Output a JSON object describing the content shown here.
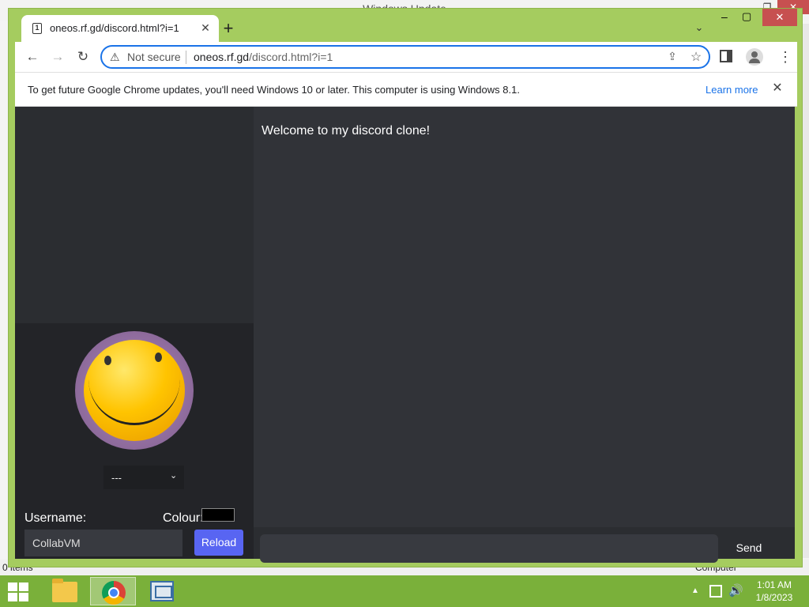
{
  "background_window": {
    "title": "Windows Update",
    "status_left": "0 items",
    "status_right": "Computer"
  },
  "browser": {
    "tab": {
      "title": "oneos.rf.gd/discord.html?i=1",
      "close_glyph": "✕"
    },
    "new_tab_glyph": "+",
    "tab_search_glyph": "⌄",
    "window_controls": {
      "minimize": "–",
      "maximize": "▢",
      "close": "✕"
    },
    "nav": {
      "back": "←",
      "forward": "→",
      "reload": "↻"
    },
    "omnibox": {
      "security_icon": "warning-triangle-icon",
      "security_label": "Not secure",
      "url_host": "oneos.rf.gd",
      "url_path": "/discord.html?i=1"
    },
    "infobar": {
      "message": "To get future Google Chrome updates, you'll need Windows 10 or later. This computer is using Windows 8.1.",
      "link": "Learn more",
      "close_glyph": "✕"
    },
    "menu_glyph": "⋮",
    "star_glyph": "☆",
    "share_glyph": "⇪"
  },
  "page": {
    "welcome_message": "Welcome to my discord clone!",
    "avatar_select": {
      "selected": "---",
      "caret": "⌄"
    },
    "username_label": "Username:",
    "colour_label": "Colour:",
    "colour_value": "#000000",
    "username_value": "CollabVM",
    "reload_label": "Reload",
    "send_label": "Send",
    "message_input_value": ""
  },
  "taskbar": {
    "apps": [
      "file-explorer",
      "google-chrome",
      "control-panel"
    ],
    "active_app": "google-chrome",
    "tray_up_glyph": "▲",
    "volume_glyph": "🔊",
    "clock_time": "1:01 AM",
    "clock_date": "1/8/2023"
  },
  "colors": {
    "window_frame": "#a5cc5f",
    "taskbar": "#7ab03a",
    "page_bg": "#313338",
    "sidebar_top": "#2b2d31",
    "sidebar_bottom": "#232428",
    "reload_button": "#5865f2",
    "link": "#1a73e8"
  }
}
